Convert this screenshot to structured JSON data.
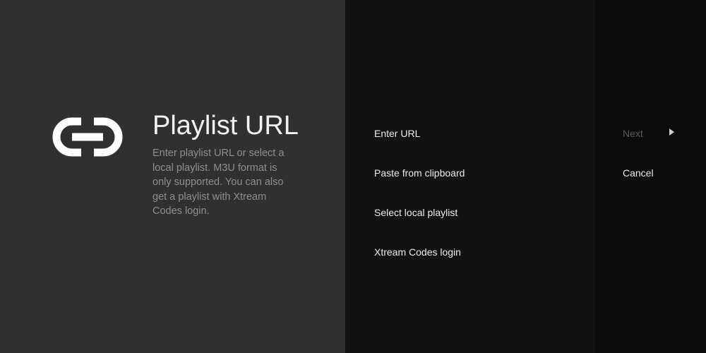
{
  "header": {
    "icon": "link-icon",
    "title": "Playlist URL",
    "description": "Enter playlist URL or select a local playlist. M3U format is only supported. You can also get a playlist with Xtream Codes login."
  },
  "actions": [
    {
      "label": "Enter URL"
    },
    {
      "label": "Paste from clipboard"
    },
    {
      "label": "Select local playlist"
    },
    {
      "label": "Xtream Codes login"
    }
  ],
  "navigation": {
    "next_label": "Next",
    "next_icon": "play-arrow-icon",
    "cancel_label": "Cancel"
  },
  "colors": {
    "left_panel": "#303030",
    "actions_panel": "#121212",
    "nav_panel": "#0b0b0b",
    "text_primary": "#ececec",
    "text_secondary": "#8f8f8f",
    "text_disabled": "#5a5a5a"
  }
}
